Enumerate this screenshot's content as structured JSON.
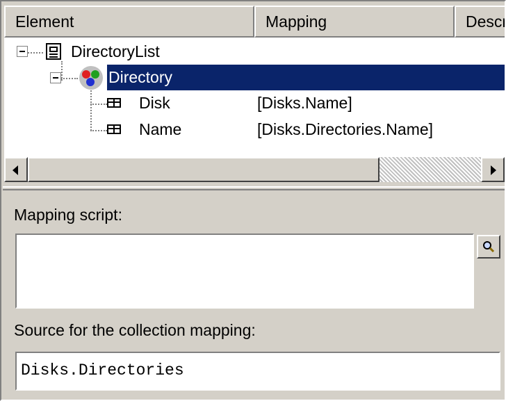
{
  "columns": {
    "element": "Element",
    "mapping": "Mapping",
    "description": "Descr"
  },
  "tree": [
    {
      "label": "DirectoryList",
      "mapping": "",
      "icon": "document-icon"
    },
    {
      "label": "Directory",
      "mapping": "",
      "icon": "collection-icon",
      "selected": true
    },
    {
      "label": "Disk",
      "mapping": "[Disks.Name]",
      "icon": "field-icon"
    },
    {
      "label": "Name",
      "mapping": "[Disks.Directories.Name]",
      "icon": "field-icon"
    }
  ],
  "selection_color": "#0a246a",
  "mapping_script": {
    "label": "Mapping script:",
    "value": ""
  },
  "collection_source": {
    "label": "Source for the collection mapping:",
    "value": "Disks.Directories"
  }
}
